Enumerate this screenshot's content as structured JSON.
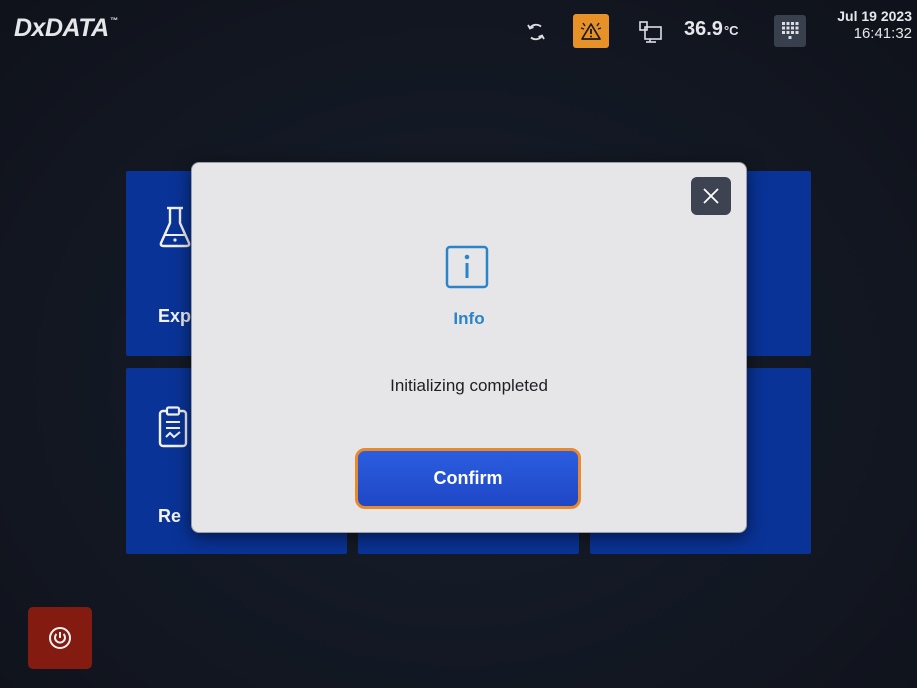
{
  "header": {
    "logo": "DxDATA",
    "logo_tm": "™",
    "temperature": "36.9",
    "temperature_unit": "°C",
    "date": "Jul 19 2023",
    "time": "16:41:32",
    "status_icons": [
      "sync-icon",
      "alarm-warning-icon",
      "network-icon",
      "keypad-icon"
    ]
  },
  "tiles": [
    {
      "label": "Exp",
      "icon": "flask-icon"
    },
    {
      "label": "",
      "icon": ""
    },
    {
      "label": "",
      "icon": ""
    },
    {
      "label": "Re",
      "icon": "clipboard-icon"
    },
    {
      "label": "",
      "icon": ""
    },
    {
      "label": "",
      "icon": ""
    }
  ],
  "dialog": {
    "title": "Info",
    "message": "Initializing completed",
    "confirm_label": "Confirm",
    "icon": "info-icon"
  },
  "colors": {
    "background": "#151a24",
    "tile": "#0a36a0",
    "alarm": "#f39a2b",
    "dialog_bg": "#e6e6e8",
    "info_accent": "#2a84c7",
    "confirm_bg": "#2352d6",
    "confirm_border": "#e9892c",
    "power_bg": "#8b1d12"
  }
}
